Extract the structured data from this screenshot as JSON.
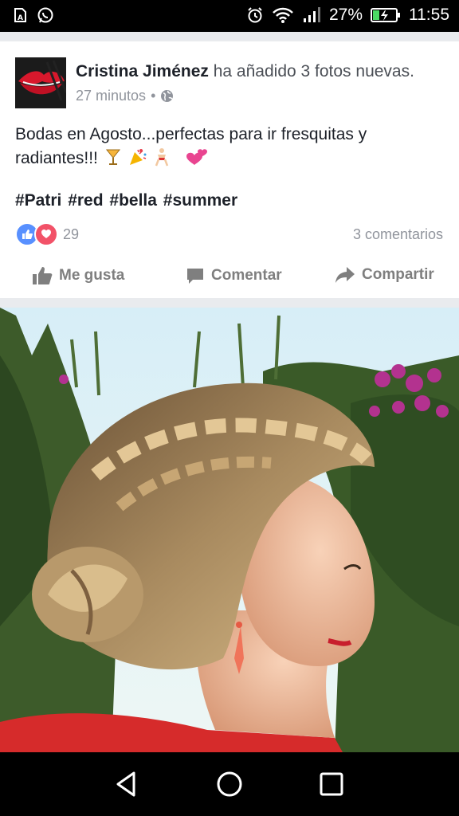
{
  "status_bar": {
    "icons_left": [
      "sim-card-alert-icon",
      "whatsapp-icon"
    ],
    "icons_right": [
      "alarm-icon",
      "wifi-icon",
      "signal-icon"
    ],
    "battery_percent": "27%",
    "battery_level": 0.27,
    "time": "11:55"
  },
  "post": {
    "author": "Cristina Jiménez",
    "action_text": " ha añadido 3 fotos nuevas.",
    "time_ago": "27 minutos",
    "separator": "•",
    "privacy_icon": "globe-icon",
    "text": "Bodas en Agosto...perfectas para ir fresquitas y radiantes!!!",
    "emojis": [
      "cocktail-icon",
      "party-popper-icon",
      "dancer-icon",
      "two-hearts-icon"
    ],
    "hashtags": "#Patri #red #bella #summer",
    "reactions": {
      "icons": [
        "like-reaction-icon",
        "love-reaction-icon"
      ],
      "count": "29"
    },
    "comments": "3 comentarios",
    "actions": {
      "like": "Me gusta",
      "comment": "Comentar",
      "share": "Compartir"
    }
  },
  "navigation_bar": {
    "buttons": [
      "back-icon",
      "home-icon",
      "recents-icon"
    ]
  },
  "colors": {
    "facebook_blue": "#5890ff",
    "love_red": "#f25268",
    "text_dark": "#1d2129",
    "text_muted": "#90949c",
    "action_gray": "#7f7f7f"
  }
}
